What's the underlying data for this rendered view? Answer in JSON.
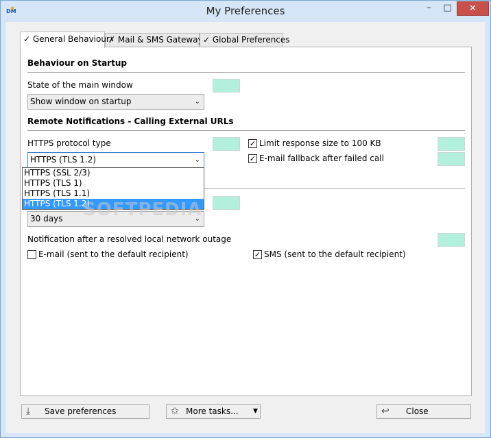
{
  "window": {
    "title": "My Preferences",
    "app_icon_text": "DM",
    "minimize": "–",
    "maximize": "□",
    "close": "✕"
  },
  "tabs": [
    {
      "label": "✓ General Behaviour",
      "active": true
    },
    {
      "label": "✗ Mail & SMS Gateways",
      "active": false
    },
    {
      "label": "✓ Global Preferences",
      "active": false
    }
  ],
  "startup": {
    "section_title": "Behaviour on Startup",
    "state_label": "State of the main window",
    "state_value": "Show window on startup"
  },
  "remote": {
    "section_title": "Remote Notifications - Calling External URLs",
    "protocol_label": "HTTPS protocol type",
    "protocol_value": "HTTPS (TLS 1.2)",
    "protocol_options": [
      "HTTPS (SSL 2/3)",
      "HTTPS (TLS 1)",
      "HTTPS (TLS 1.1)",
      "HTTPS (TLS 1.2)"
    ],
    "limit_label": "Limit response size to 100 KB",
    "limit_checked": true,
    "fallback_label": "E-mail fallback after failed call",
    "fallback_checked": true
  },
  "history": {
    "value": "30 days"
  },
  "outage": {
    "label": "Notification after a resolved local network outage",
    "email_label": "E-mail (sent to the default recipient)",
    "email_checked": false,
    "sms_label": "SMS (sent to the default recipient)",
    "sms_checked": true
  },
  "swatch_color": "#b2f0dd",
  "watermark": "SOFTPEDIA",
  "buttons": {
    "save": "Save preferences",
    "more": "More tasks...",
    "close": "Close"
  }
}
